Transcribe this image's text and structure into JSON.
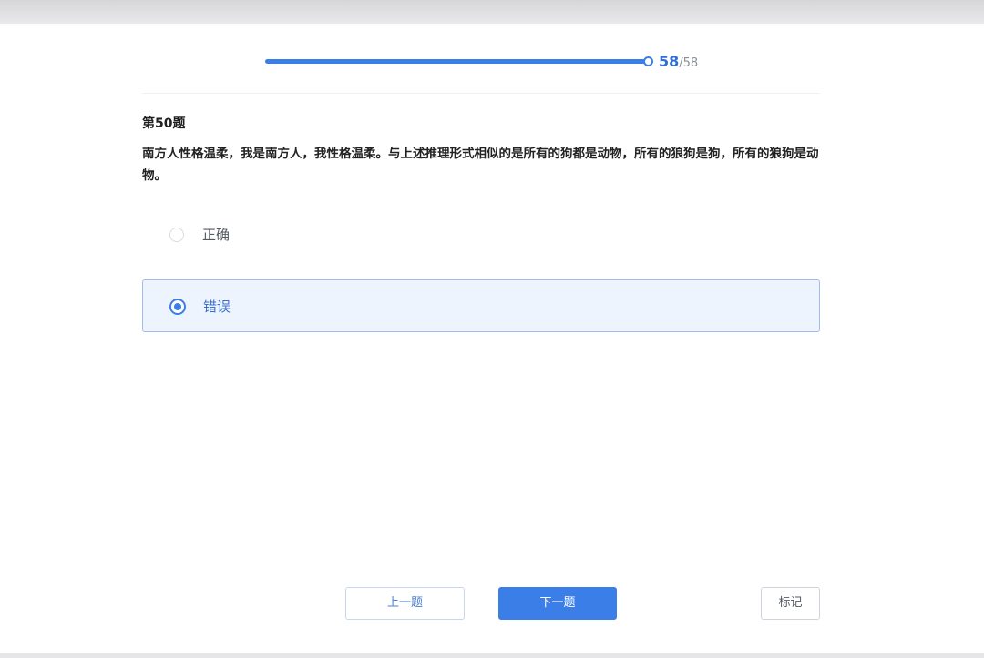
{
  "progress": {
    "current": "58",
    "separator": "/",
    "total": "58",
    "fraction": 1.0,
    "color": "#3b7ee8"
  },
  "question": {
    "number_label": "第50题",
    "text": "南方人性格温柔，我是南方人，我性格温柔。与上述推理形式相似的是所有的狗都是动物，所有的狼狗是狗，所有的狼狗是动物。"
  },
  "options": [
    {
      "label": "正确",
      "selected": false
    },
    {
      "label": "错误",
      "selected": true
    }
  ],
  "buttons": {
    "prev_label": "上一题",
    "next_label": "下一题",
    "mark_label": "标记"
  },
  "colors": {
    "accent": "#3b7ee8",
    "selected_bg": "#eef4fd"
  }
}
